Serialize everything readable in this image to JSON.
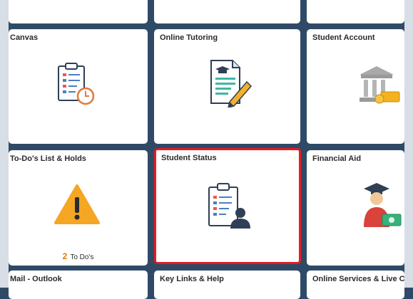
{
  "tiles": {
    "canvas": {
      "title": "Canvas",
      "icon": "clipboard-clock-icon"
    },
    "online_tutoring": {
      "title": "Online Tutoring",
      "icon": "document-pencil-icon"
    },
    "student_account": {
      "title": "Student Account",
      "icon": "bank-money-icon"
    },
    "todo": {
      "title": "To-Do's List & Holds",
      "icon": "warning-icon",
      "count": "2",
      "count_label": "To Do's"
    },
    "student_status": {
      "title": "Student Status",
      "icon": "clipboard-person-icon"
    },
    "financial_aid": {
      "title": "Financial Aid",
      "icon": "graduate-money-icon"
    },
    "mail": {
      "title": "Mail - Outlook"
    },
    "key_links": {
      "title": "Key Links & Help"
    },
    "online_services": {
      "title": "Online Services & Live Chat"
    }
  },
  "colors": {
    "background": "#2f4a66",
    "selected_border": "#e41b23",
    "warning": "#f5a623"
  }
}
